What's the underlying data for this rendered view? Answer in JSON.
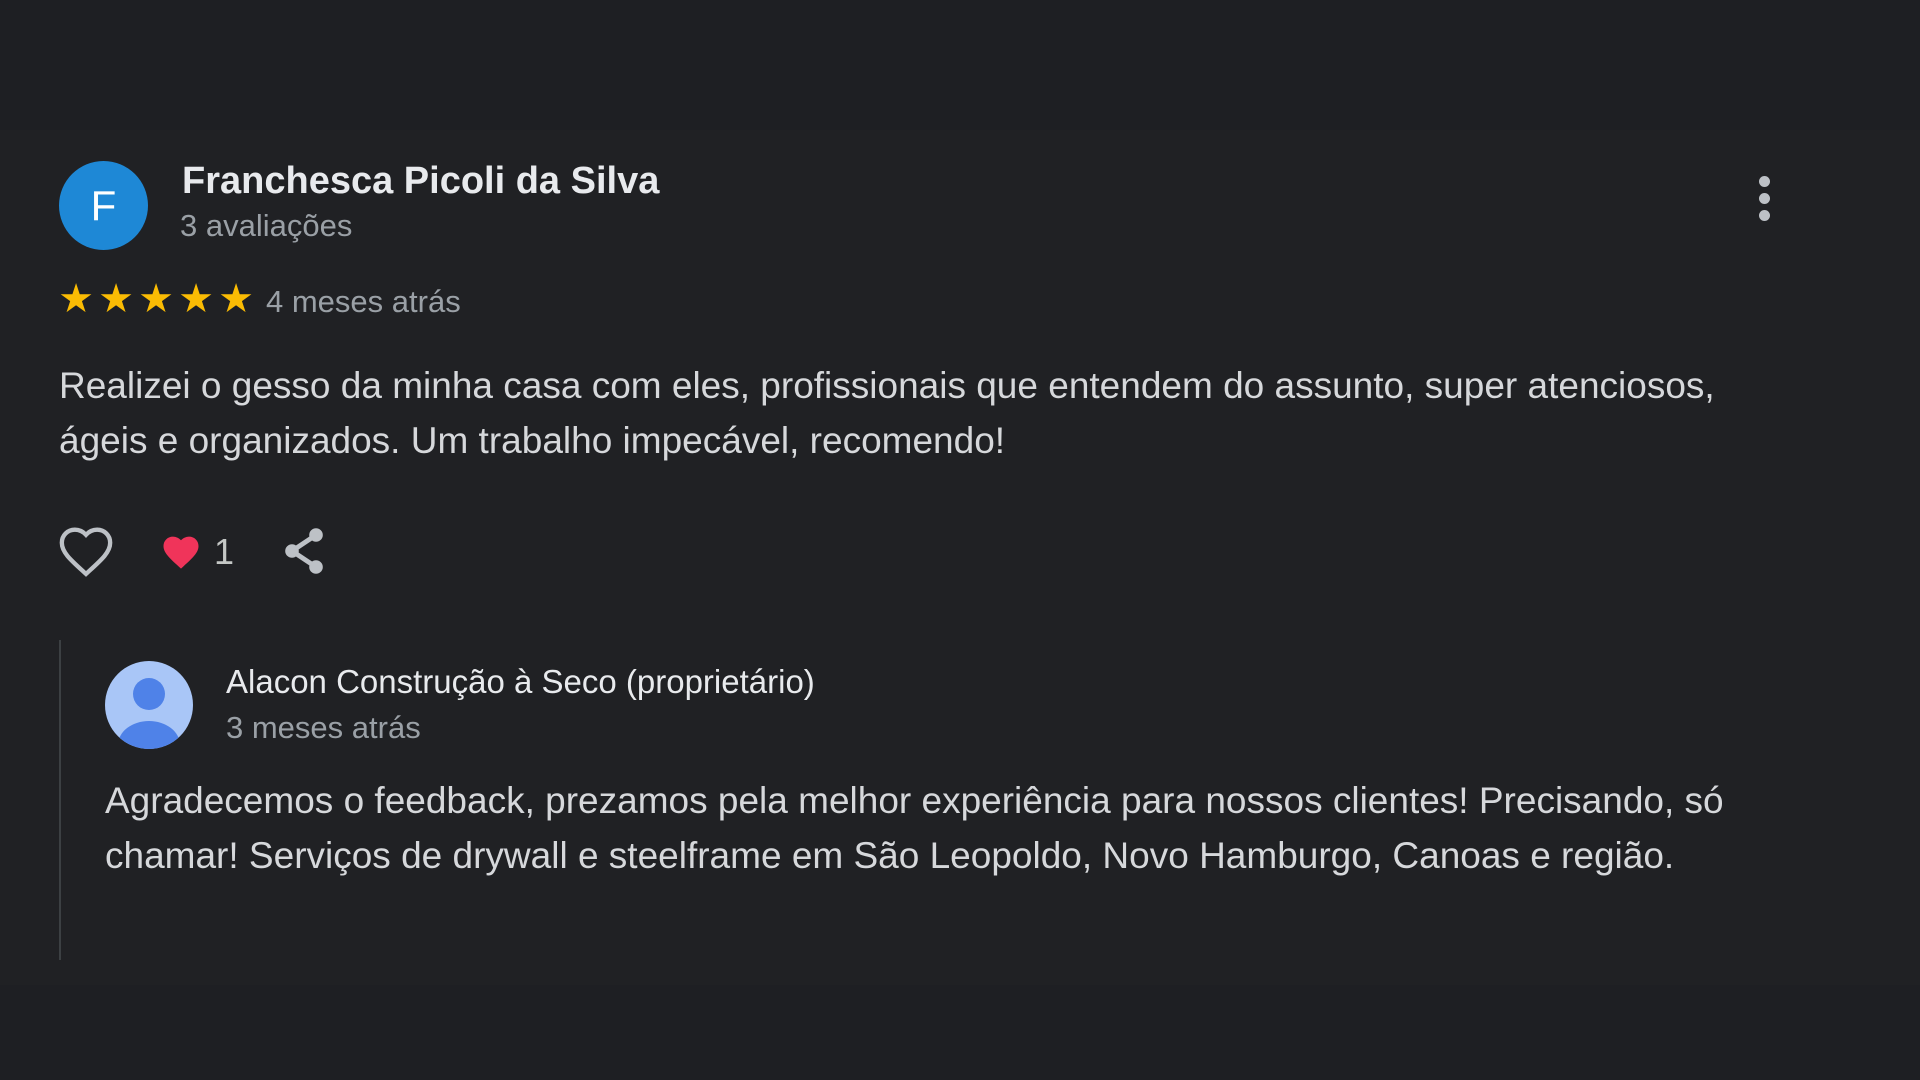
{
  "review": {
    "avatar_letter": "F",
    "avatar_color": "#1e88d6",
    "author_name": "Franchesca Picoli da Silva",
    "author_meta": "3 avaliações",
    "rating": 5,
    "time": "4 meses atrás",
    "text": "Realizei o gesso da minha casa com eles, profissionais que entendem do assunto, super atenciosos, ágeis e organizados. Um trabalho impecável, recomendo!",
    "menu_icon": "more-vert-icon"
  },
  "actions": {
    "like_icon": "heart-outline-icon",
    "reaction_icon": "heart-filled-icon",
    "reaction_count": "1",
    "share_icon": "share-icon"
  },
  "reply": {
    "author_name": "Alacon Construção à Seco (proprietário)",
    "time": "3 meses atrás",
    "text": "Agradecemos o feedback, prezamos pela melhor experiência para nossos clientes! Precisando, só chamar! Serviços de drywall e steelframe em São Leopoldo, Novo Hamburgo, Canoas e região."
  },
  "colors": {
    "star": "#fbbc04",
    "reaction_heart": "#f0345a",
    "background": "#202124"
  }
}
